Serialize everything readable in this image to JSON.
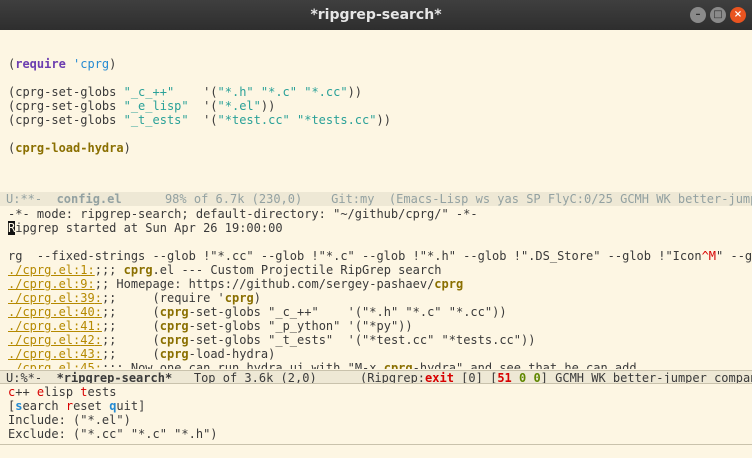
{
  "window": {
    "title": "*ripgrep-search*"
  },
  "config_buffer": {
    "line1": {
      "open": "(",
      "kw": "require",
      "sym": " 'cprg",
      "close": ")"
    },
    "line2": {
      "open": "(cprg-set-globs ",
      "name": "\"_c_++\"",
      "pad": "    '(",
      "globs": "\"*.h\" \"*.c\" \"*.cc\"",
      "close": "))"
    },
    "line3": {
      "open": "(cprg-set-globs ",
      "name": "\"_e_lisp\"",
      "pad": "  '(",
      "globs": "\"*.el\"",
      "close": "))"
    },
    "line4": {
      "open": "(cprg-set-globs ",
      "name": "\"_t_ests\"",
      "pad": "  '(",
      "globs": "\"*test.cc\" \"*tests.cc\"",
      "close": "))"
    },
    "line5": {
      "open": "(",
      "fn": "cprg-load-hydra",
      "close": ")"
    }
  },
  "modeline_top": {
    "state": "U:**-  ",
    "buffer": "config.el",
    "rest": "      98% of 6.7k (230,0)    Git:my  (Emacs-Lisp ws yas SP FlyC:0/25 GCMH WK better-jumper c"
  },
  "ripgrep_buffer": {
    "header": "-*- mode: ripgrep-search; default-directory: \"~/github/cprg/\" -*-",
    "started_cursor": "R",
    "started_rest": "ipgrep started at Sun Apr 26 19:00:00",
    "command": "rg  --fixed-strings --glob !\"*.cc\" --glob !\"*.c\" --glob !\"*.h\" --glob !\".DS_Store\" --glob !\"Icon",
    "command_ctrl": "^M",
    "command_tail": "\" --glo",
    "results": [
      {
        "file": "./cprg.el",
        "num": "1",
        "pre": ";;; ",
        "match": "cprg",
        "post": ".el --- Custom Projectile RipGrep search"
      },
      {
        "file": "./cprg.el",
        "num": "9",
        "pre": ";; Homepage: https://github.com/sergey-pashaev/",
        "match": "cprg",
        "post": ""
      },
      {
        "file": "./cprg.el",
        "num": "39",
        "pre": ";;     (require '",
        "match": "cprg",
        "post": ")"
      },
      {
        "file": "./cprg.el",
        "num": "40",
        "pre": ";;     (",
        "match": "cprg",
        "post": "-set-globs \"_c_++\"    '(\"*.h\" \"*.c\" \"*.cc\"))"
      },
      {
        "file": "./cprg.el",
        "num": "41",
        "pre": ";;     (",
        "match": "cprg",
        "post": "-set-globs \"_p_ython\" '(\"*py\"))"
      },
      {
        "file": "./cprg.el",
        "num": "42",
        "pre": ";;     (",
        "match": "cprg",
        "post": "-set-globs \"_t_ests\"  '(\"*test.cc\" \"*tests.cc\"))"
      },
      {
        "file": "./cprg.el",
        "num": "43",
        "pre": ";;     (",
        "match": "cprg",
        "post": "-load-hydra)"
      },
      {
        "file": "./cprg.el",
        "num": "45",
        "pre": ";;; Now one can run hydra ui with \"M-x ",
        "match": "cprg",
        "post": "-hydra\" and see that he can add"
      }
    ]
  },
  "modeline_bottom": {
    "state": "U:%*-  ",
    "buffer": "*ripgrep-search*",
    "pos": "   Top of 3.6k (2,0)      (Ripgrep:",
    "exit": "exit",
    "exit_code": " [0] [",
    "count": "51",
    "zero1": " 0",
    "zero2": " 0",
    "tail": "] GCMH WK better-jumper company-b"
  },
  "hydra": {
    "langs": [
      {
        "key": "c",
        "rest": "++ "
      },
      {
        "key": "e",
        "rest": "lisp "
      },
      {
        "key": "t",
        "rest": "ests"
      }
    ],
    "actions_open": "[",
    "actions": [
      {
        "key": "s",
        "rest": "earch "
      },
      {
        "key": "r",
        "rest": "eset "
      },
      {
        "key": "q",
        "rest": "uit"
      }
    ],
    "actions_close": "]",
    "include": "Include: (\"*.el\")",
    "exclude": "Exclude: (\"*.cc\" \"*.c\" \"*.h\")"
  },
  "colors": {
    "background": "#fdf6e3",
    "keyword": "#6c3db0",
    "string": "#2aa198",
    "link": "#b58900",
    "error": "#d70000",
    "success": "#5f8700"
  }
}
